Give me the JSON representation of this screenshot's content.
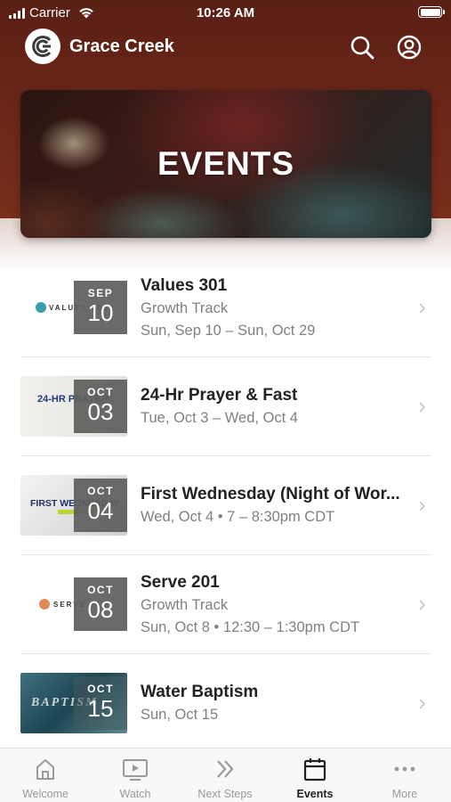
{
  "status_bar": {
    "carrier": "Carrier",
    "time": "10:26 AM"
  },
  "app": {
    "title": "Grace Creek",
    "logo_icon": "grace-creek-logo"
  },
  "header": {
    "search_icon": "search-icon",
    "account_icon": "account-icon"
  },
  "hero": {
    "title": "EVENTS"
  },
  "events": [
    {
      "title": "Values 301",
      "subtitle": "Growth Track",
      "dates": "Sun, Sep 10 – Sun, Oct 29",
      "month": "SEP",
      "day": "10",
      "thumb_text": "VALUES 301"
    },
    {
      "title": "24-Hr Prayer & Fast",
      "subtitle": "Tue, Oct 3 – Wed, Oct 4",
      "dates": "",
      "month": "OCT",
      "day": "03",
      "thumb_text": "24-HR PRAYER"
    },
    {
      "title": "First Wednesday (Night of Wor...",
      "subtitle": "Wed, Oct 4 • 7 – 8:30pm CDT",
      "dates": "",
      "month": "OCT",
      "day": "04",
      "thumb_text": "FIRST WEDNESDAY"
    },
    {
      "title": "Serve 201",
      "subtitle": "Growth Track",
      "dates": "Sun, Oct 8 • 12:30 – 1:30pm CDT",
      "month": "OCT",
      "day": "08",
      "thumb_text": "SERVE 201"
    },
    {
      "title": "Water Baptism",
      "subtitle": "Sun, Oct 15",
      "dates": "",
      "month": "OCT",
      "day": "15",
      "thumb_text": "BAPTISM"
    }
  ],
  "tabs": [
    {
      "label": "Welcome",
      "icon": "home-icon",
      "active": false
    },
    {
      "label": "Watch",
      "icon": "tv-icon",
      "active": false
    },
    {
      "label": "Next Steps",
      "icon": "double-chevron-icon",
      "active": false
    },
    {
      "label": "Events",
      "icon": "calendar-icon",
      "active": true
    },
    {
      "label": "More",
      "icon": "more-icon",
      "active": false
    }
  ],
  "colors": {
    "header": "#6e2818",
    "date_badge": "#5f5f5f",
    "active_tab": "#222222",
    "inactive_tab": "#9a9a9a"
  }
}
